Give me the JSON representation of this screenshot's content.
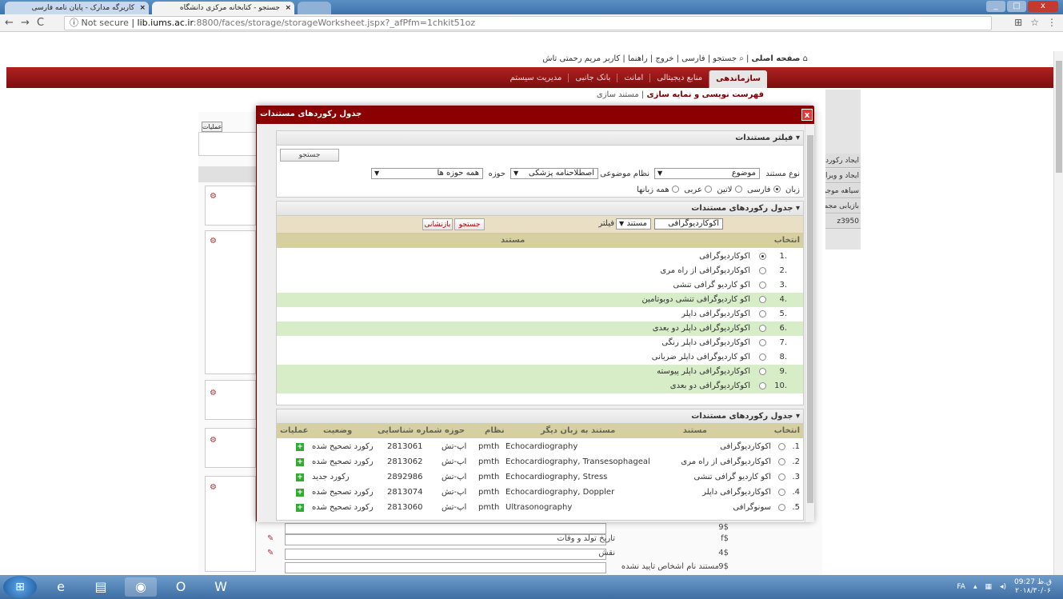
{
  "browser": {
    "tabs": [
      {
        "label": "کاربرگه مدارک - پایان نامه فارسی"
      },
      {
        "label": "جستجو - کتابخانه مرکزی دانشگاه"
      }
    ],
    "url_secure": "Not secure",
    "url_host": "lib.iums.ac.ir",
    "url_path": ":8800/faces/storage/storageWorksheet.jspx?_afPfm=1chkit51oz"
  },
  "topmenu": {
    "home": "صفحه اصلی",
    "search": "جستجو",
    "lang": "فارسی",
    "exit": "خروج",
    "help": "راهنما",
    "user": "کاربر مریم رحمتی تاش"
  },
  "navtabs": [
    "سازماندهی",
    "منابع دیجیتالی",
    "امانت",
    "بانک جانبی",
    "مدیریت سیستم"
  ],
  "breadcrumb": {
    "main": "فهرست نویسی و نمایه سازی",
    "sub": "مستند سازی"
  },
  "side_items": [
    "ایجاد رکورد",
    "ایجاد و ویرایش",
    "سیاهه موجودی",
    "بازیابی مجموعه",
    "z3950"
  ],
  "bg": {
    "ops_label": "عملیات",
    "rows": [
      {
        "code": "9$",
        "label": ""
      },
      {
        "code": "$f",
        "label": "تاریخ تولد و وفات"
      },
      {
        "code": "4$",
        "label": "نقش"
      },
      {
        "code": "9$",
        "label": "مستند نام اشخاص تایید نشده"
      }
    ]
  },
  "modal": {
    "title": "جدول رکوردهای مستندات",
    "close": "x",
    "filter_section": {
      "header": "فیلتر مستندات",
      "search_btn": "جستجو",
      "doc_type_label": "نوع مستند",
      "doc_type_value": "موضوع",
      "system_label": "نظام موضوعی",
      "system_value": "اصطلاحنامه پزشکی",
      "domain_label": "حوزه",
      "domain_value": "همه حوزه ها",
      "lang_label": "زبان",
      "langs": [
        "فارسی",
        "لاتین",
        "عربی",
        "همه زبانها"
      ]
    },
    "table1": {
      "header": "جدول رکوردهای مستندات",
      "filter_label": "فیلتر",
      "filter_select": "مستند",
      "filter_value": "اکوکاردیوگرافی",
      "search_btn": "جستجو",
      "reset_btn": "بازنشانی",
      "col_select": "انتخاب",
      "col_doc": "مستند",
      "rows": [
        {
          "num": ".1",
          "text": "اکوکاردیوگرافی"
        },
        {
          "num": ".2",
          "text": "اکوکاردیوگرافی از راه مری"
        },
        {
          "num": ".3",
          "text": "اکو کاردیو گرافی تنشی"
        },
        {
          "num": ".4",
          "text": "اکو کاردیوگرافی تنشی دوبوتامین"
        },
        {
          "num": ".5",
          "text": "اکوکاردیوگرافی داپلر"
        },
        {
          "num": ".6",
          "text": "اکوکاردیوگرافی داپلر دو بعدی"
        },
        {
          "num": ".7",
          "text": "اکوکاردیوگرافی داپلر رنگی"
        },
        {
          "num": ".8",
          "text": "اکو کاردیوگرافی داپلر ضربانی"
        },
        {
          "num": ".9",
          "text": "اکوکاردیوگرافی داپلر پیوسته"
        },
        {
          "num": ".10",
          "text": "اکوکاردیوگرافی دو بعدی"
        }
      ]
    },
    "table2": {
      "header": "جدول رکوردهای مستندات",
      "cols": {
        "select": "انتخاب",
        "doc": "مستند",
        "other_lang": "مستند به زبان دیگر",
        "system": "نظام",
        "domain": "حوزه",
        "id": "شماره شناسایی",
        "status": "وضعیت",
        "ops": "عملیات"
      },
      "rows": [
        {
          "num": ".1",
          "doc": "اکوکاردیوگرافی",
          "other": "Echocardiography",
          "system": "pmth",
          "domain": "اپ-تش",
          "id": "2813061",
          "status": "رکورد تصحیح شده"
        },
        {
          "num": ".2",
          "doc": "اکوکاردیوگرافی از راه مری",
          "other": "Echocardiography, Transesophageal",
          "system": "pmth",
          "domain": "اپ-تش",
          "id": "2813062",
          "status": "رکورد تصحیح شده"
        },
        {
          "num": ".3",
          "doc": "اکو کاردیو گرافی تنشی",
          "other": "Echocardiography, Stress",
          "system": "pmth",
          "domain": "اپ-تش",
          "id": "2892986",
          "status": "رکورد جدید"
        },
        {
          "num": ".4",
          "doc": "اکوکاردیوگرافی داپلر",
          "other": "Echocardiography, Doppler",
          "system": "pmth",
          "domain": "اپ-تش",
          "id": "2813074",
          "status": "رکورد تصحیح شده"
        },
        {
          "num": ".5",
          "doc": "سونوگرافی",
          "other": "Ultrasonography",
          "system": "pmth",
          "domain": "اپ-تش",
          "id": "2813060",
          "status": "رکورد تصحیح شده"
        }
      ]
    }
  },
  "taskbar": {
    "lang": "FA",
    "time": "09:27 ق.ظ",
    "date": "۲۰۱۸/۳۰/۰۶"
  }
}
